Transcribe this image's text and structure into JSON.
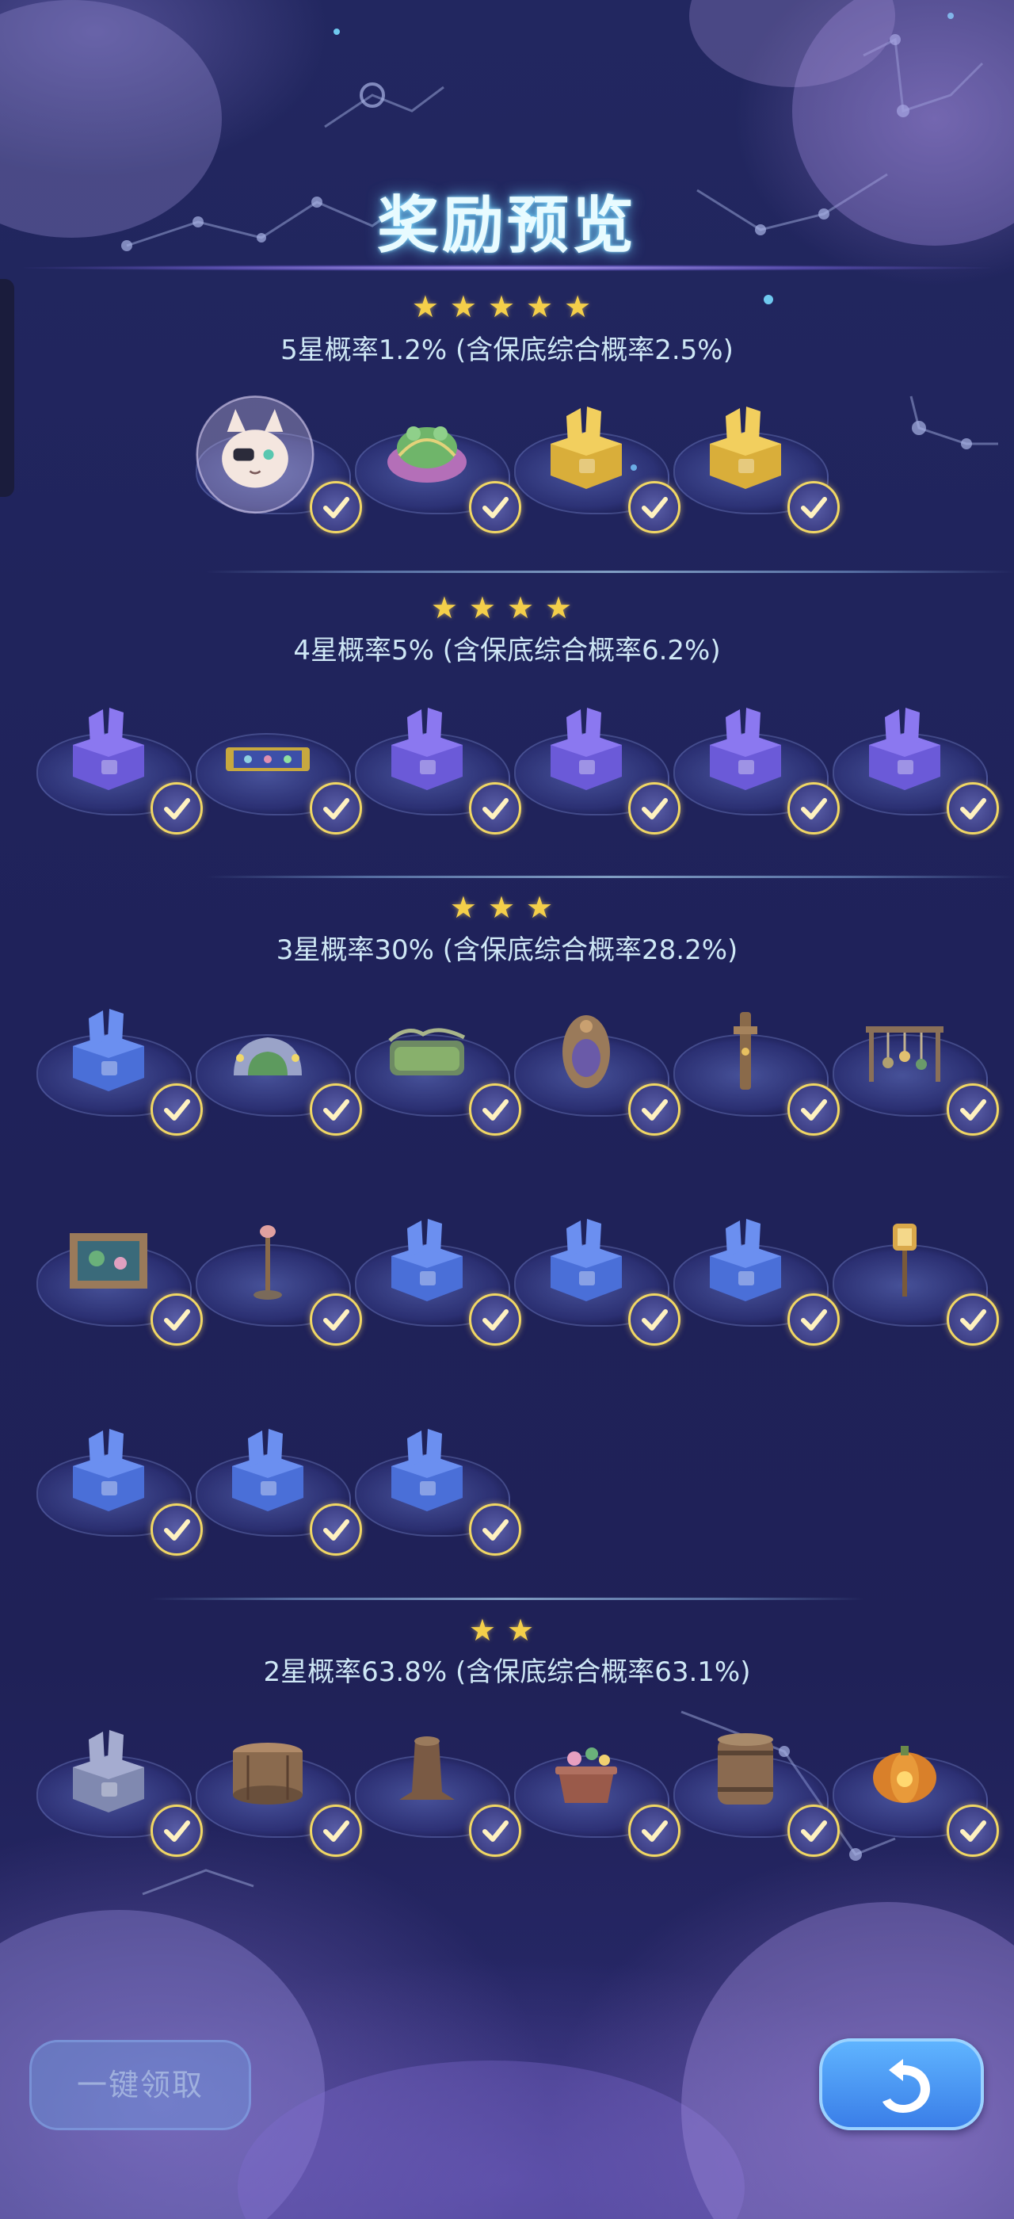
{
  "screen_title": "奖励预览",
  "tiers": [
    {
      "stars": 5,
      "rate_label": "5星概率1.2% (含保底综合概率2.5%)",
      "rows": [
        [
          "cat-pirate-avatar-icon",
          "frog-float-icon",
          "gold-box-icon",
          "gold-box-icon"
        ]
      ]
    },
    {
      "stars": 4,
      "rate_label": "4星概率5% (含保底综合概率6.2%)",
      "rows": [
        [
          "purple-box-icon",
          "pattern-tile-icon",
          "purple-box-icon",
          "purple-box-icon",
          "purple-box-icon",
          "purple-box-icon"
        ]
      ]
    },
    {
      "stars": 3,
      "rate_label": "3星概率30% (含保底综合概率28.2%)",
      "rows": [
        [
          "blue-box-icon",
          "stone-arch-icon",
          "green-bed-icon",
          "round-door-icon",
          "wooden-post-icon",
          "hanging-tools-icon"
        ],
        [
          "picture-frame-icon",
          "lamp-stand-icon",
          "blue-box-icon",
          "blue-box-icon",
          "blue-box-icon",
          "lantern-post-icon"
        ],
        [
          "blue-box-icon",
          "blue-box-icon",
          "blue-box-icon"
        ]
      ]
    },
    {
      "stars": 2,
      "rate_label": "2星概率63.8% (含保底综合概率63.1%)",
      "rows": [
        [
          "gray-box-icon",
          "wooden-stool-icon",
          "tree-stump-icon",
          "flower-pot-icon",
          "wooden-barrel-icon",
          "pumpkin-lamp-icon"
        ]
      ]
    }
  ],
  "claim_button": "一键领取",
  "back_button_icon": "return-arrow-icon",
  "check_icon": "checkmark-icon",
  "colors": {
    "star": "#f4cf4a",
    "check_ring": "#f1d764",
    "back_button": "#4a97f5"
  }
}
